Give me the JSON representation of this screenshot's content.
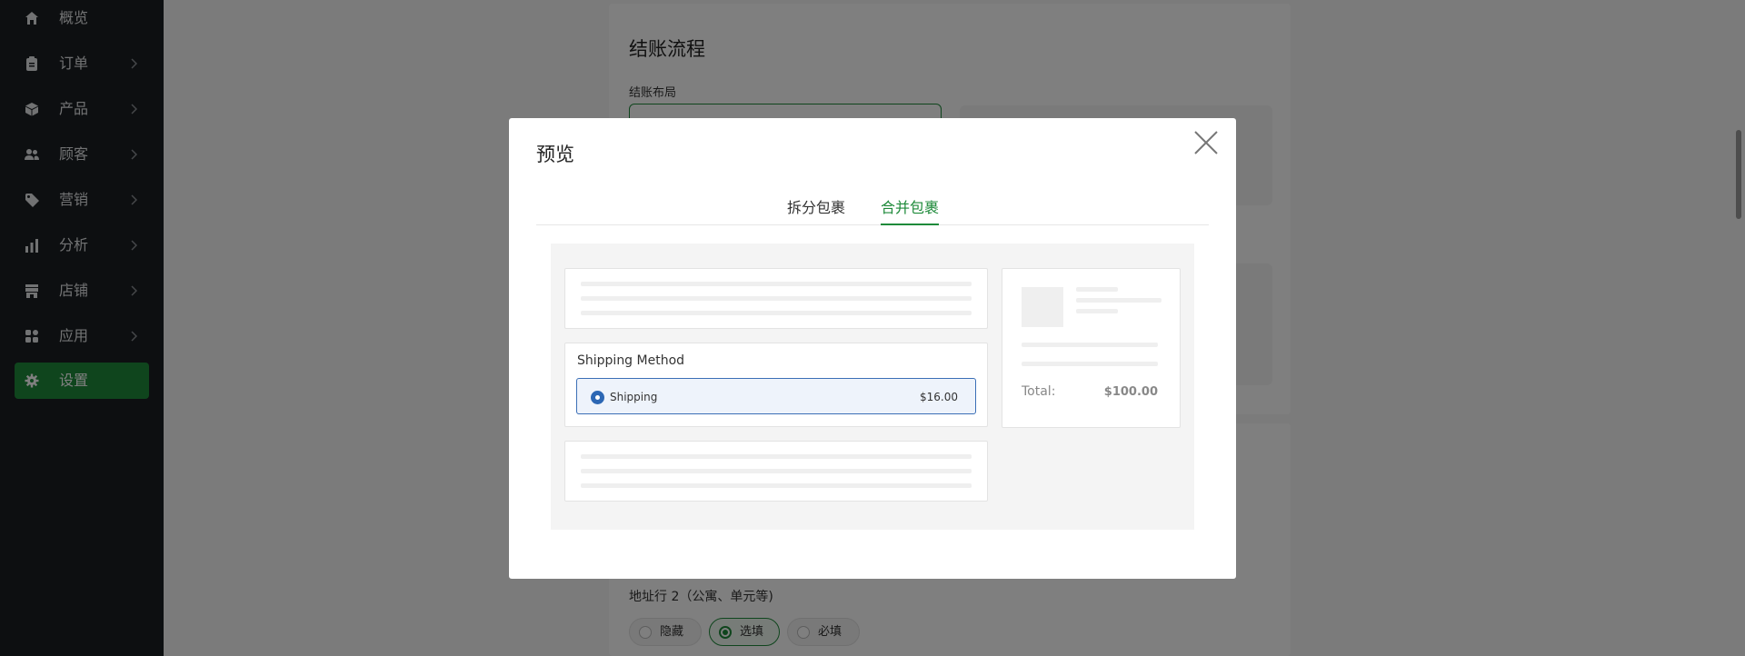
{
  "sidebar": {
    "items": [
      {
        "label": "概览",
        "icon": "home-icon",
        "has_chevron": false
      },
      {
        "label": "订单",
        "icon": "clipboard-icon",
        "has_chevron": true
      },
      {
        "label": "产品",
        "icon": "box-icon",
        "has_chevron": true
      },
      {
        "label": "顾客",
        "icon": "users-icon",
        "has_chevron": true
      },
      {
        "label": "营销",
        "icon": "tag-icon",
        "has_chevron": true
      },
      {
        "label": "分析",
        "icon": "bar-chart-icon",
        "has_chevron": true
      },
      {
        "label": "店铺",
        "icon": "store-icon",
        "has_chevron": true
      },
      {
        "label": "应用",
        "icon": "apps-icon",
        "has_chevron": true
      },
      {
        "label": "设置",
        "icon": "gear-icon",
        "has_chevron": false,
        "active": true
      }
    ]
  },
  "main": {
    "checkout_card": {
      "title": "结账流程",
      "layout_label": "结账布局"
    },
    "address_line2": {
      "label": "地址行 2（公寓、单元等)",
      "options": [
        {
          "label": "隐藏",
          "selected": false
        },
        {
          "label": "选填",
          "selected": true
        },
        {
          "label": "必填",
          "selected": false
        }
      ]
    }
  },
  "modal": {
    "title": "预览",
    "tabs": [
      {
        "label": "拆分包裹",
        "active": false
      },
      {
        "label": "合并包裹",
        "active": true
      }
    ],
    "preview": {
      "shipping_method_title": "Shipping Method",
      "shipping_option_label": "Shipping",
      "shipping_option_price": "$16.00",
      "total_label": "Total:",
      "total_value": "$100.00"
    }
  },
  "colors": {
    "sidebar_bg": "#1b1f22",
    "accent_green": "#1e8a3a",
    "selected_blue": "#2c67b4",
    "overlay": "rgba(0,0,0,0.5)"
  }
}
